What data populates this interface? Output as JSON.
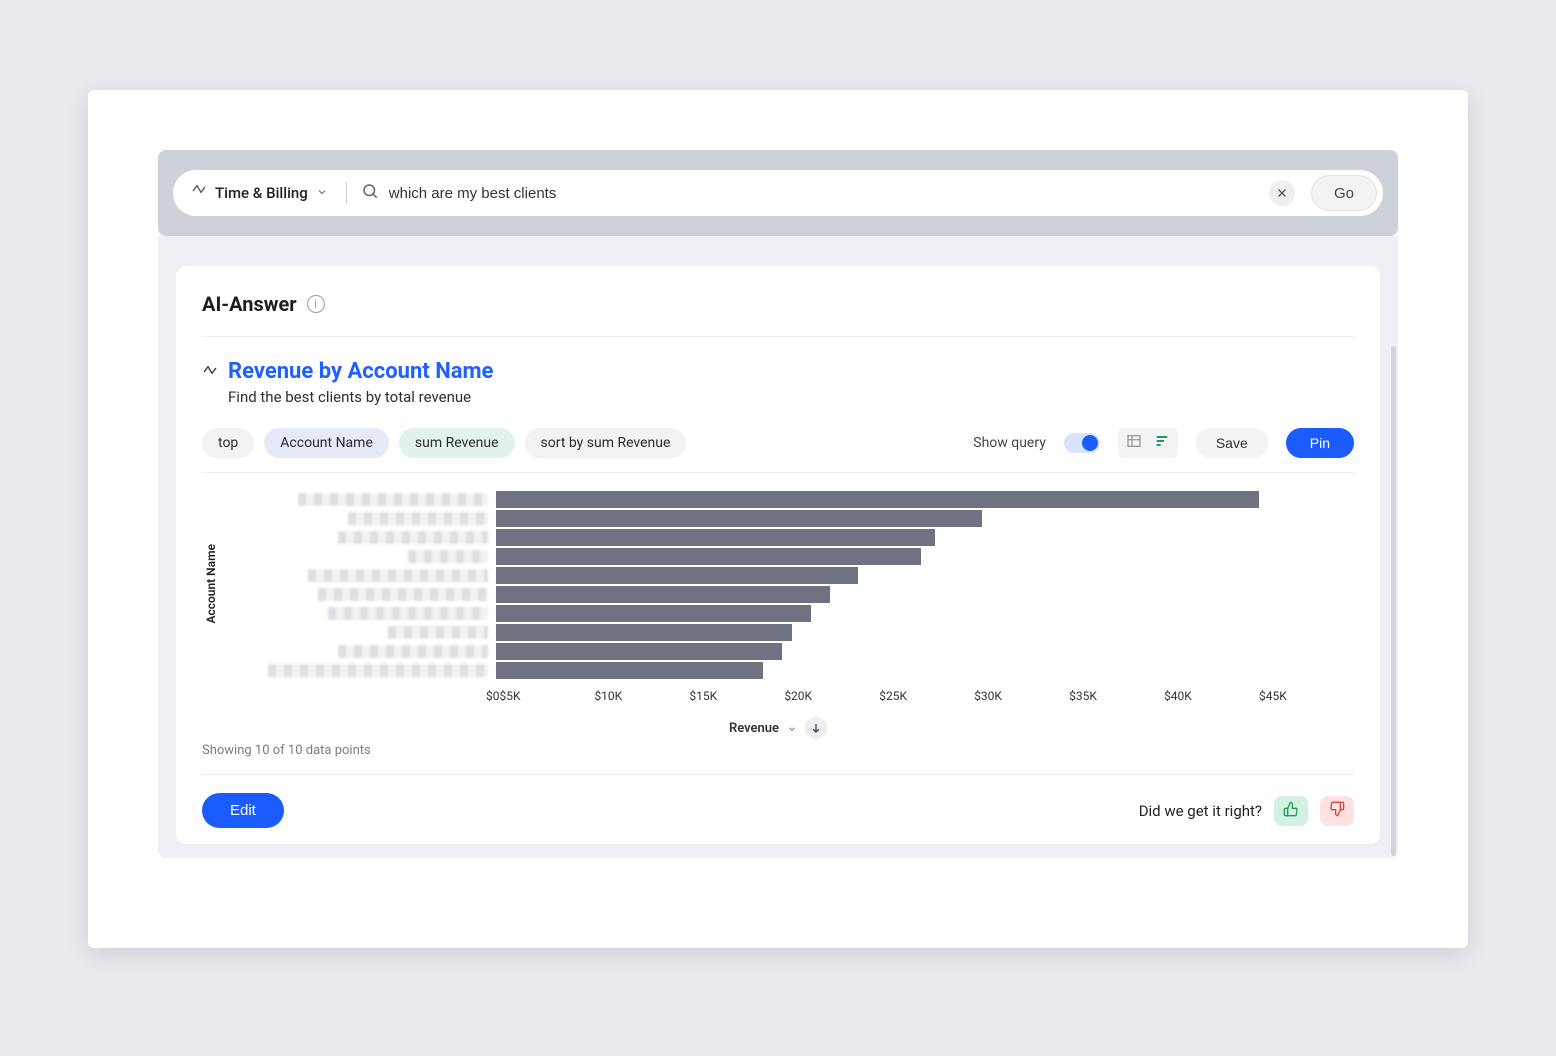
{
  "search": {
    "datasource_label": "Time & Billing",
    "query": "which are my best clients",
    "go_label": "Go"
  },
  "panel": {
    "header": "AI-Answer"
  },
  "result": {
    "title": "Revenue by Account Name",
    "subtitle": "Find the best clients by total revenue"
  },
  "chips": {
    "top": "top",
    "account_name": "Account Name",
    "sum_revenue": "sum Revenue",
    "sort": "sort by sum Revenue"
  },
  "toolbar": {
    "show_query": "Show query",
    "save": "Save",
    "pin": "Pin"
  },
  "axis": {
    "y_label": "Account Name",
    "x_label": "Revenue",
    "ticks": [
      "$0",
      "$5K",
      "$10K",
      "$15K",
      "$20K",
      "$25K",
      "$30K",
      "$35K",
      "$40K",
      "$45K"
    ]
  },
  "datapoints": "Showing 10 of 10 data points",
  "footer": {
    "edit": "Edit",
    "feedback_q": "Did we get it right?"
  },
  "chart_data": {
    "type": "bar",
    "orientation": "horizontal",
    "ylabel": "Account Name",
    "xlabel": "Revenue",
    "xlim": [
      0,
      45000
    ],
    "note": "Category labels are redacted/blurred in the source image",
    "values": [
      40000,
      25500,
      23000,
      22300,
      19000,
      17500,
      16500,
      15500,
      15000,
      14000
    ],
    "label_widths": [
      190,
      140,
      150,
      80,
      180,
      170,
      160,
      100,
      150,
      220
    ]
  }
}
